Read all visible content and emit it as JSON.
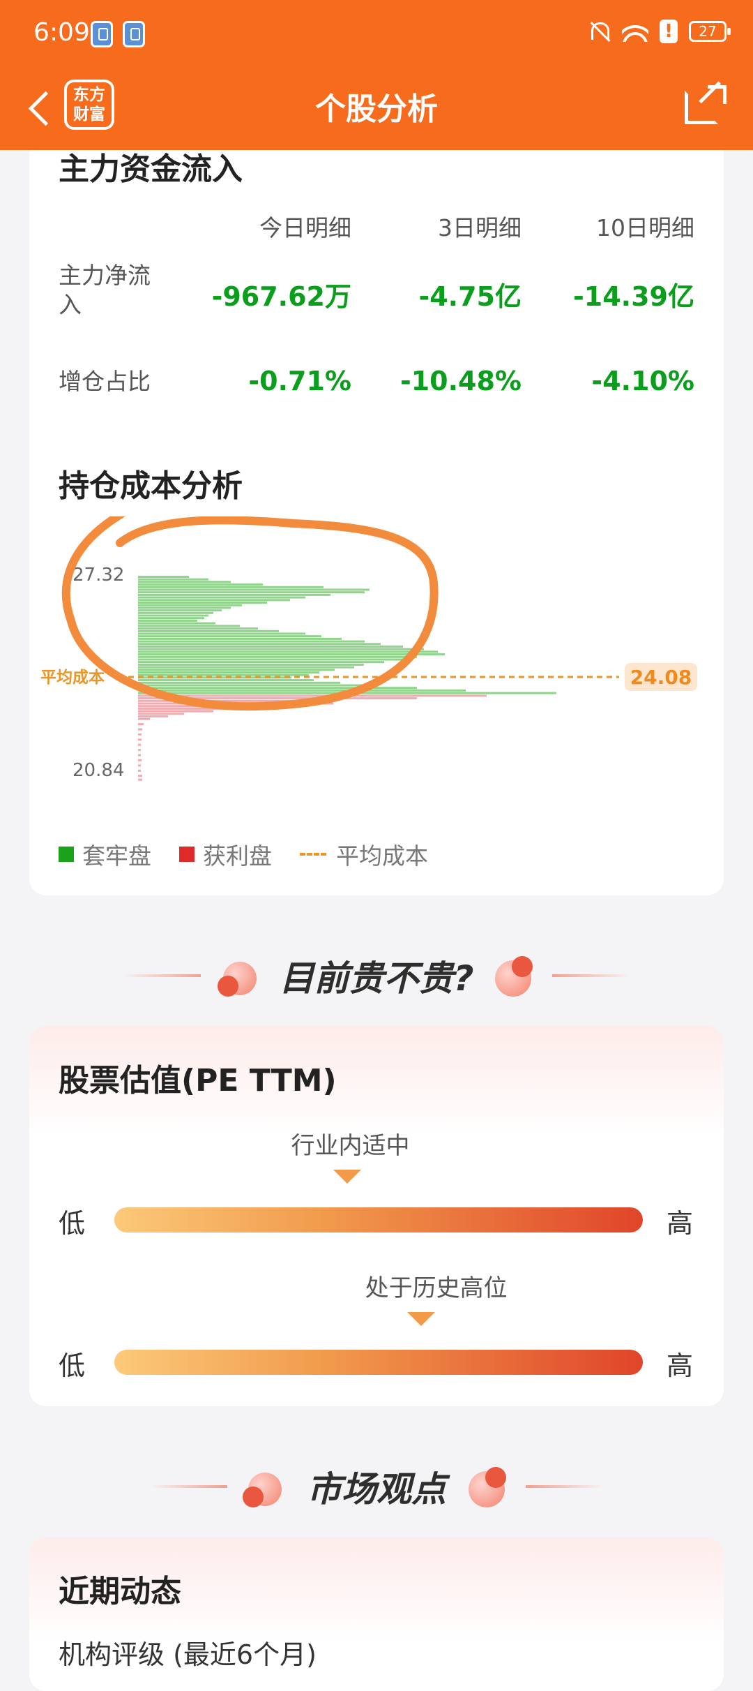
{
  "status_bar": {
    "time": "6:09",
    "battery": "27"
  },
  "nav": {
    "logo_line1": "东方",
    "logo_line2": "财富",
    "title": "个股分析"
  },
  "capital_flow": {
    "title": "主力资金流入",
    "columns": [
      "今日明细",
      "3日明细",
      "10日明细"
    ],
    "rows": [
      {
        "label": "主力净流入",
        "values": [
          "-967.62万",
          "-4.75亿",
          "-14.39亿"
        ]
      },
      {
        "label": "增仓占比",
        "values": [
          "-0.71%",
          "-10.48%",
          "-4.10%"
        ]
      }
    ]
  },
  "cost_analysis": {
    "title": "持仓成本分析",
    "avg_label": "平均成本",
    "legend": {
      "trapped": "套牢盘",
      "profit": "获利盘",
      "avg": "平均成本"
    }
  },
  "chart_data": {
    "type": "bar",
    "orientation": "horizontal",
    "y_top_label": "27.32",
    "y_bottom_label": "20.84",
    "ylim": [
      20.84,
      27.32
    ],
    "average_cost": 24.08,
    "average_cost_label": "24.08",
    "series": [
      {
        "name": "套牢盘",
        "color": "#8fd48a",
        "bars": [
          {
            "price": 27.18,
            "value": 73
          },
          {
            "price": 27.1,
            "value": 101
          },
          {
            "price": 27.02,
            "value": 133
          },
          {
            "price": 26.94,
            "value": 179
          },
          {
            "price": 26.86,
            "value": 266
          },
          {
            "price": 26.78,
            "value": 332
          },
          {
            "price": 26.7,
            "value": 325
          },
          {
            "price": 26.62,
            "value": 276
          },
          {
            "price": 26.54,
            "value": 240
          },
          {
            "price": 26.46,
            "value": 218
          },
          {
            "price": 26.38,
            "value": 185
          },
          {
            "price": 26.3,
            "value": 149
          },
          {
            "price": 26.22,
            "value": 133
          },
          {
            "price": 26.14,
            "value": 120
          },
          {
            "price": 26.06,
            "value": 108
          },
          {
            "price": 25.98,
            "value": 101
          },
          {
            "price": 25.9,
            "value": 95
          },
          {
            "price": 25.82,
            "value": 85
          },
          {
            "price": 25.74,
            "value": 111
          },
          {
            "price": 25.66,
            "value": 146
          },
          {
            "price": 25.58,
            "value": 172
          },
          {
            "price": 25.5,
            "value": 202
          },
          {
            "price": 25.42,
            "value": 240
          },
          {
            "price": 25.34,
            "value": 263
          },
          {
            "price": 25.26,
            "value": 292
          },
          {
            "price": 25.18,
            "value": 325
          },
          {
            "price": 25.1,
            "value": 348
          },
          {
            "price": 25.02,
            "value": 380
          },
          {
            "price": 24.94,
            "value": 410
          },
          {
            "price": 24.86,
            "value": 430
          },
          {
            "price": 24.78,
            "value": 440
          },
          {
            "price": 24.7,
            "value": 400
          },
          {
            "price": 24.62,
            "value": 380
          },
          {
            "price": 24.54,
            "value": 353
          },
          {
            "price": 24.46,
            "value": 324
          },
          {
            "price": 24.38,
            "value": 310
          },
          {
            "price": 24.3,
            "value": 282
          },
          {
            "price": 24.22,
            "value": 260
          },
          {
            "price": 24.14,
            "value": 245
          },
          {
            "price": 24.06,
            "value": 220
          },
          {
            "price": 23.98,
            "value": 252
          },
          {
            "price": 23.9,
            "value": 290
          },
          {
            "price": 23.82,
            "value": 330
          },
          {
            "price": 23.74,
            "value": 400
          },
          {
            "price": 23.66,
            "value": 470
          },
          {
            "price": 23.58,
            "value": 600
          }
        ]
      },
      {
        "name": "获利盘",
        "color": "#f0aab0",
        "bars": [
          {
            "price": 23.5,
            "value": 500
          },
          {
            "price": 23.42,
            "value": 400
          },
          {
            "price": 23.34,
            "value": 260
          },
          {
            "price": 23.26,
            "value": 280
          },
          {
            "price": 23.18,
            "value": 200
          },
          {
            "price": 23.1,
            "value": 180
          },
          {
            "price": 23.02,
            "value": 108
          },
          {
            "price": 22.94,
            "value": 66
          },
          {
            "price": 22.86,
            "value": 43
          },
          {
            "price": 22.78,
            "value": 17
          },
          {
            "price": 22.62,
            "value": 8
          },
          {
            "price": 22.46,
            "value": 6
          },
          {
            "price": 22.3,
            "value": 5
          },
          {
            "price": 22.14,
            "value": 5
          },
          {
            "price": 21.98,
            "value": 4
          },
          {
            "price": 21.82,
            "value": 4
          },
          {
            "price": 21.66,
            "value": 4
          },
          {
            "price": 21.5,
            "value": 5
          },
          {
            "price": 21.34,
            "value": 4
          },
          {
            "price": 21.18,
            "value": 4
          },
          {
            "price": 21.02,
            "value": 6
          },
          {
            "price": 20.9,
            "value": 6
          }
        ]
      }
    ]
  },
  "banner1": {
    "text": "目前贵不贵?"
  },
  "valuation": {
    "title": "股票估值(PE TTM)",
    "industry_label": "行业内适中",
    "industry_level": 0.44,
    "history_label": "处于历史高位",
    "history_level": 0.58,
    "low": "低",
    "high": "高"
  },
  "banner2": {
    "text": "市场观点"
  },
  "recent": {
    "title": "近期动态",
    "rating": "机构评级 (最近6个月)"
  }
}
